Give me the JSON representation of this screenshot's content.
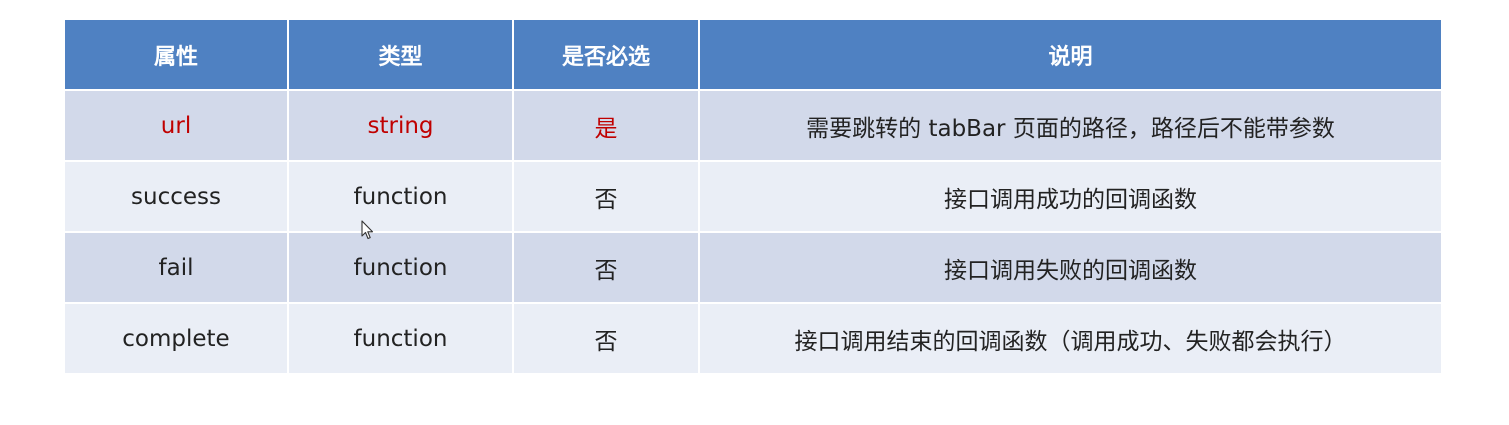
{
  "table": {
    "headers": [
      "属性",
      "类型",
      "是否必选",
      "说明"
    ],
    "rows": [
      {
        "property": "url",
        "type": "string",
        "required": "是",
        "description": "需要跳转的 tabBar 页面的路径，路径后不能带参数"
      },
      {
        "property": "success",
        "type": "function",
        "required": "否",
        "description": "接口调用成功的回调函数"
      },
      {
        "property": "fail",
        "type": "function",
        "required": "否",
        "description": "接口调用失败的回调函数"
      },
      {
        "property": "complete",
        "type": "function",
        "required": "否",
        "description": "接口调用结束的回调函数（调用成功、失败都会执行）"
      }
    ]
  },
  "colors": {
    "header_bg": "#4f81c2",
    "row_dark": "#d2d9ea",
    "row_light": "#eaeef6",
    "highlight_text": "#c00000"
  },
  "icons": {
    "cursor": "mouse-pointer-icon"
  }
}
